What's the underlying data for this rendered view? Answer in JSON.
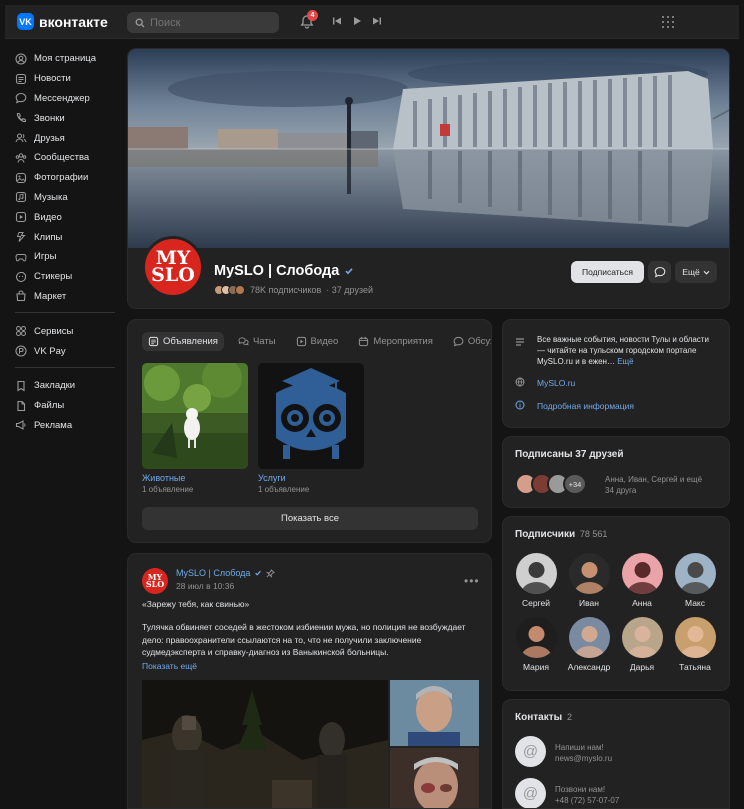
{
  "app": {
    "logo_mark": "VK",
    "logo_text": "вконтакте"
  },
  "header": {
    "search_placeholder": "Поиск",
    "notification_count": "4"
  },
  "sidebar": {
    "items": [
      {
        "label": "Моя страница",
        "icon": "user-circle-icon"
      },
      {
        "label": "Новости",
        "icon": "news-icon"
      },
      {
        "label": "Мессенджер",
        "icon": "message-icon"
      },
      {
        "label": "Звонки",
        "icon": "phone-icon"
      },
      {
        "label": "Друзья",
        "icon": "friends-icon"
      },
      {
        "label": "Сообщества",
        "icon": "communities-icon"
      },
      {
        "label": "Фотографии",
        "icon": "photo-icon"
      },
      {
        "label": "Музыка",
        "icon": "music-icon"
      },
      {
        "label": "Видео",
        "icon": "video-icon"
      },
      {
        "label": "Клипы",
        "icon": "clips-icon"
      },
      {
        "label": "Игры",
        "icon": "games-icon"
      },
      {
        "label": "Стикеры",
        "icon": "stickers-icon"
      },
      {
        "label": "Маркет",
        "icon": "market-icon"
      }
    ],
    "items2": [
      {
        "label": "Сервисы",
        "icon": "services-icon"
      },
      {
        "label": "VK Pay",
        "icon": "vkpay-icon"
      }
    ],
    "items3": [
      {
        "label": "Закладки",
        "icon": "bookmark-icon"
      },
      {
        "label": "Файлы",
        "icon": "file-icon"
      },
      {
        "label": "Реклама",
        "icon": "ads-icon"
      }
    ]
  },
  "group": {
    "avatar_line1": "MY",
    "avatar_line2": "SLO",
    "name": "MySLO | Слобода",
    "followers": "78K подписчиков",
    "friends": "· 37 друзей",
    "subscribe_label": "Подписаться",
    "more_label": "Ещё"
  },
  "tabs": [
    {
      "label": "Объявления",
      "icon": "ads-tab-icon",
      "active": true
    },
    {
      "label": "Чаты",
      "icon": "chats-icon",
      "active": false
    },
    {
      "label": "Видео",
      "icon": "video-tab-icon",
      "active": false
    },
    {
      "label": "Мероприятия",
      "icon": "calendar-icon",
      "active": false
    },
    {
      "label": "Обсуждения",
      "icon": "discussion-icon",
      "active": false
    }
  ],
  "listings": [
    {
      "title": "Животные",
      "sub": "1 объявление"
    },
    {
      "title": "Услуги",
      "sub": "1 объявление"
    }
  ],
  "show_all_label": "Показать все",
  "post": {
    "author": "MySLO | Слобода",
    "date": "28 июл в 10:36",
    "title": "«Зарежу тебя, как свинью»",
    "text": "Тулячка обвиняет соседей в жестоком избиении мужа, но полиция не возбуждает дело: правоохранители ссылаются на то, что не получили заключение судмедэксперта и справку-диагноз из Ваныкинской больницы.",
    "more": "Показать ещё"
  },
  "info": {
    "description": "Все важные события, новости Тулы и области — читайте на тульском городском портале MySLO.ru и в ежен…",
    "description_more": "Ещё",
    "site": "MySLO.ru",
    "details": "Подробная информация"
  },
  "friends_block": {
    "title": "Подписаны 37 друзей",
    "more_count": "+34",
    "names": "Анна, Иван, Сергей и ещё",
    "others": "34 друга"
  },
  "subscribers": {
    "title": "Подписчики",
    "count": "78 561",
    "people": [
      {
        "name": "Сергей"
      },
      {
        "name": "Иван"
      },
      {
        "name": "Анна"
      },
      {
        "name": "Макс"
      },
      {
        "name": "Мария"
      },
      {
        "name": "Александр"
      },
      {
        "name": "Дарья"
      },
      {
        "name": "Татьяна"
      }
    ]
  },
  "contacts": {
    "title": "Контакты",
    "count": "2",
    "items": [
      {
        "line1": "Напиши нам!",
        "line2": "news@myslo.ru"
      },
      {
        "line1": "Позвони нам!",
        "line2": "+48 (72) 57-07-07"
      }
    ]
  },
  "colors": {
    "accent": "#71aaeb",
    "brand": "#0077ff",
    "brand_red": "#d8261f",
    "background": "#141414",
    "card": "#222222"
  }
}
